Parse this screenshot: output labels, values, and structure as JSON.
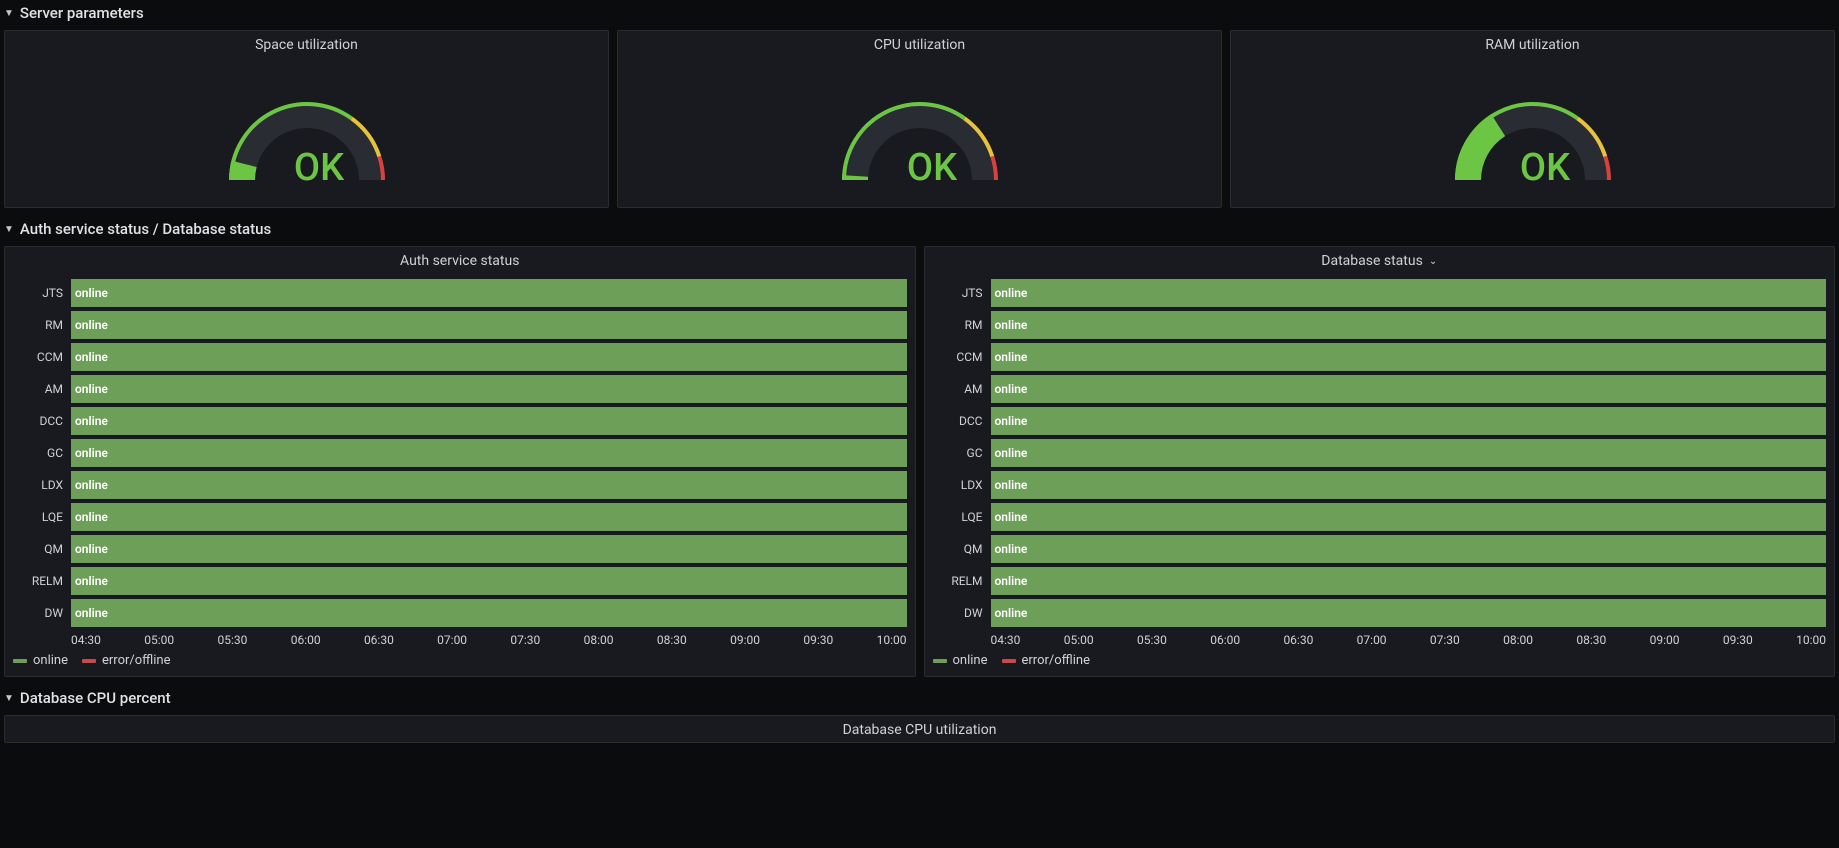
{
  "sections": {
    "server_params": "Server parameters",
    "auth_db": "Auth service status / Database status",
    "db_cpu": "Database CPU percent"
  },
  "gauges": [
    {
      "title": "Space utilization",
      "value_pct": 8,
      "status_text": "OK",
      "status_color": "#6cc644"
    },
    {
      "title": "CPU utilization",
      "value_pct": 2,
      "status_text": "OK",
      "status_color": "#6cc644"
    },
    {
      "title": "RAM utilization",
      "value_pct": 32,
      "status_text": "OK",
      "status_color": "#6cc644"
    }
  ],
  "gauge_thresholds": {
    "yellow_start_pct": 70,
    "red_start_pct": 90
  },
  "status_panels": {
    "left": {
      "title": "Auth service status",
      "has_chevron": false
    },
    "right": {
      "title": "Database status",
      "has_chevron": true
    }
  },
  "status_rows": [
    "JTS",
    "RM",
    "CCM",
    "AM",
    "DCC",
    "GC",
    "LDX",
    "LQE",
    "QM",
    "RELM",
    "DW"
  ],
  "status_value_text": "online",
  "status_value_color": "#6e9f59",
  "x_ticks": [
    "04:30",
    "05:00",
    "05:30",
    "06:00",
    "06:30",
    "07:00",
    "07:30",
    "08:00",
    "08:30",
    "09:00",
    "09:30",
    "10:00"
  ],
  "legend": [
    {
      "label": "online",
      "swatch": "sw-green"
    },
    {
      "label": "error/offline",
      "swatch": "sw-red"
    }
  ],
  "bottom_panel_title": "Database CPU utilization",
  "chart_data": [
    {
      "type": "gauge",
      "title": "Space utilization",
      "value_pct": 8,
      "thresholds": {
        "yellow": 70,
        "red": 90
      },
      "status": "OK"
    },
    {
      "type": "gauge",
      "title": "CPU utilization",
      "value_pct": 2,
      "thresholds": {
        "yellow": 70,
        "red": 90
      },
      "status": "OK"
    },
    {
      "type": "gauge",
      "title": "RAM utilization",
      "value_pct": 32,
      "thresholds": {
        "yellow": 70,
        "red": 90
      },
      "status": "OK"
    },
    {
      "type": "status-timeline",
      "title": "Auth service status",
      "x_range": [
        "04:30",
        "10:00"
      ],
      "categories": [
        "JTS",
        "RM",
        "CCM",
        "AM",
        "DCC",
        "GC",
        "LDX",
        "LQE",
        "QM",
        "RELM",
        "DW"
      ],
      "values": [
        "online",
        "online",
        "online",
        "online",
        "online",
        "online",
        "online",
        "online",
        "online",
        "online",
        "online"
      ],
      "states": {
        "online": "#6e9f59",
        "error/offline": "#c94848"
      }
    },
    {
      "type": "status-timeline",
      "title": "Database status",
      "x_range": [
        "04:30",
        "10:00"
      ],
      "categories": [
        "JTS",
        "RM",
        "CCM",
        "AM",
        "DCC",
        "GC",
        "LDX",
        "LQE",
        "QM",
        "RELM",
        "DW"
      ],
      "values": [
        "online",
        "online",
        "online",
        "online",
        "online",
        "online",
        "online",
        "online",
        "online",
        "online",
        "online"
      ],
      "states": {
        "online": "#6e9f59",
        "error/offline": "#c94848"
      }
    }
  ]
}
